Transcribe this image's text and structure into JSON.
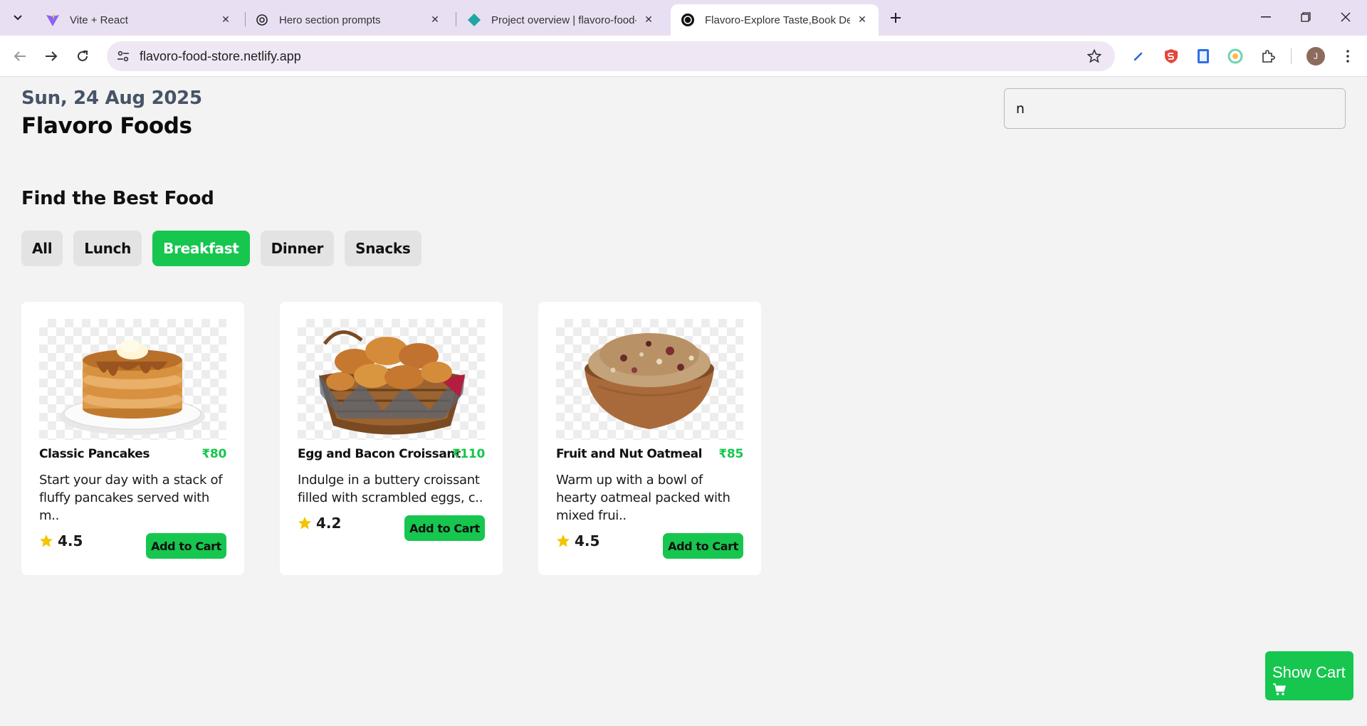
{
  "browser": {
    "tabs": [
      {
        "title": "Vite + React",
        "favicon": "vite-icon"
      },
      {
        "title": "Hero section prompts",
        "favicon": "openai-icon"
      },
      {
        "title": "Project overview | flavoro-food-",
        "favicon": "netlify-icon"
      },
      {
        "title": "Flavoro-Explore Taste,Book Deli",
        "favicon": "flavoro-icon",
        "active": true
      }
    ],
    "url": "flavoro-food-store.netlify.app",
    "profile_initial": "J"
  },
  "header": {
    "date": "Sun, 24 Aug 2025",
    "brand": "Flavoro Foods",
    "search_value": "n"
  },
  "section_title": "Find the Best Food",
  "categories": [
    {
      "label": "All",
      "active": false
    },
    {
      "label": "Lunch",
      "active": false
    },
    {
      "label": "Breakfast",
      "active": true
    },
    {
      "label": "Dinner",
      "active": false
    },
    {
      "label": "Snacks",
      "active": false
    }
  ],
  "foods": [
    {
      "name": "Classic Pancakes",
      "price": "₹80",
      "desc": "Start your day with a stack of fluffy pancakes served with m..",
      "rating": "4.5",
      "image": "pancakes",
      "add_label": "Add to Cart"
    },
    {
      "name": "Egg and Bacon Croissant",
      "price": "₹110",
      "desc": "Indulge in a buttery croissant filled with scrambled eggs, c..",
      "rating": "4.2",
      "image": "croissant-basket",
      "add_label": "Add to Cart"
    },
    {
      "name": "Fruit and Nut Oatmeal",
      "price": "₹85",
      "desc": "Warm up with a bowl of hearty oatmeal packed with mixed frui..",
      "rating": "4.5",
      "image": "oatmeal-bowl",
      "add_label": "Add to Cart"
    }
  ],
  "show_cart_label": "Show Cart",
  "colors": {
    "accent": "#16c64f",
    "tabbar": "#e9dff2",
    "star": "#f5c400"
  }
}
